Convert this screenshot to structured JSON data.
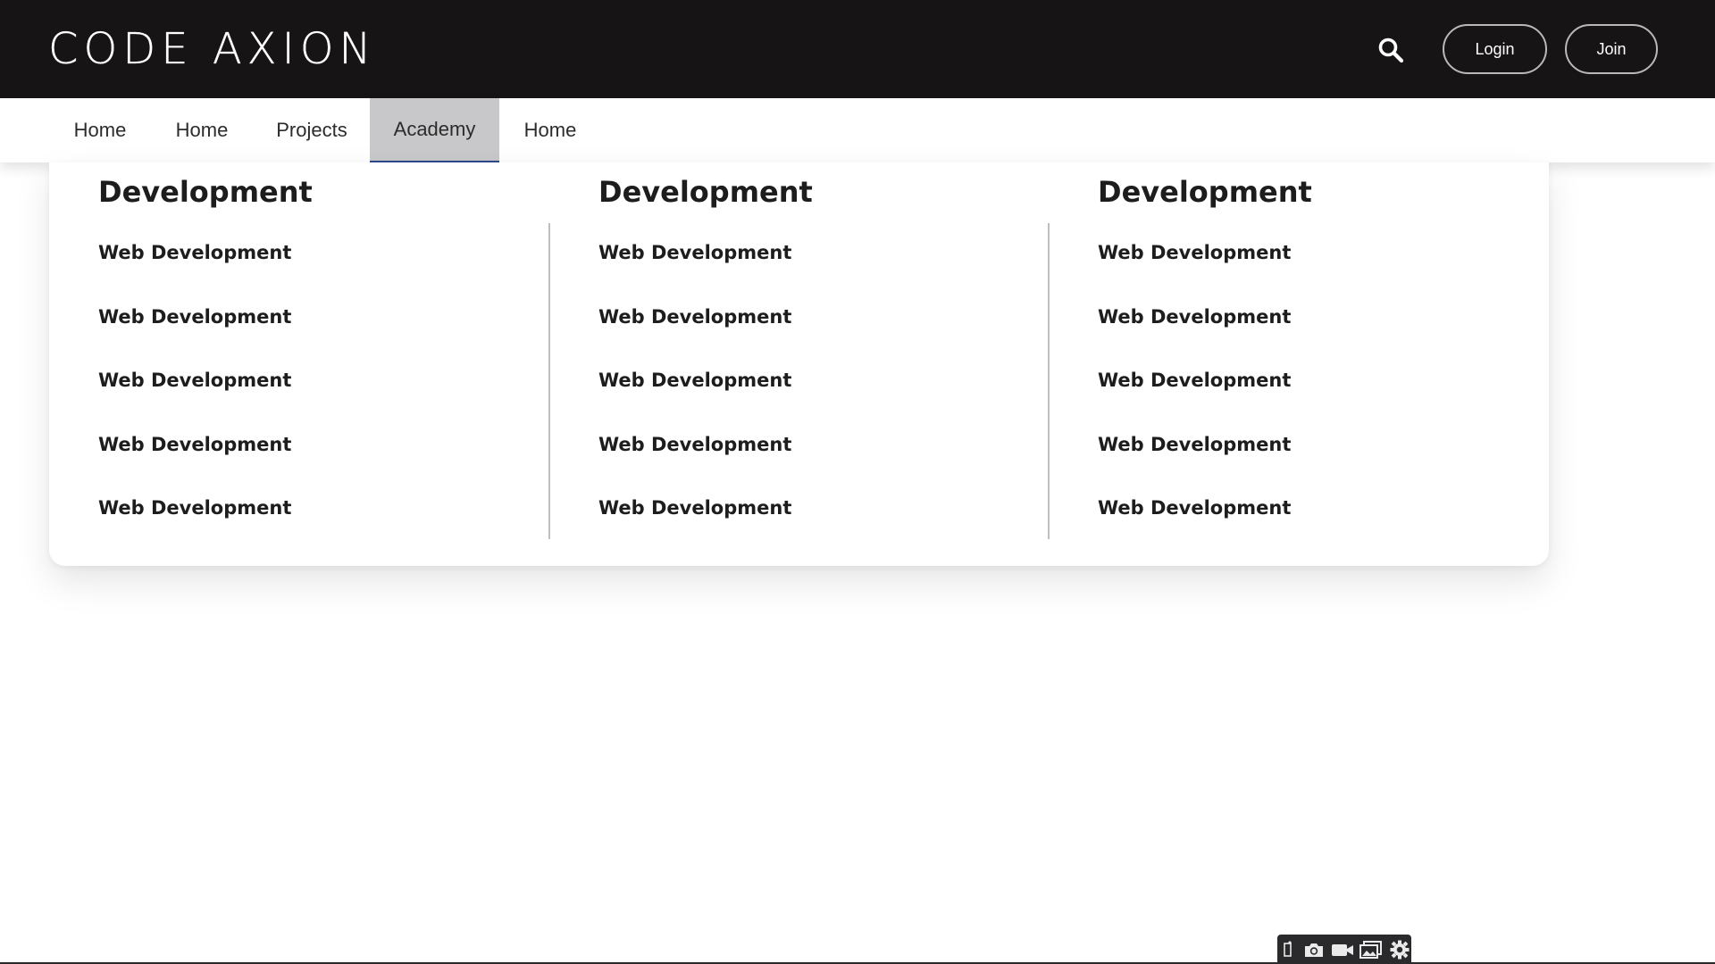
{
  "header": {
    "logo_text": "CODE AXION",
    "search_icon": "search-icon",
    "login_label": "Login",
    "join_label": "Join"
  },
  "nav": {
    "items": [
      {
        "label": "Home"
      },
      {
        "label": "Home"
      },
      {
        "label": "Projects"
      },
      {
        "label": "Academy",
        "active": true
      },
      {
        "label": "Home"
      }
    ]
  },
  "mega_menu": {
    "columns": [
      {
        "title": "Development",
        "links": [
          "Web Development",
          "Web Development",
          "Web Development",
          "Web Development",
          "Web Development"
        ]
      },
      {
        "title": "Development",
        "links": [
          "Web Development",
          "Web Development",
          "Web Development",
          "Web Development",
          "Web Development"
        ]
      },
      {
        "title": "Development",
        "links": [
          "Web Development",
          "Web Development",
          "Web Development",
          "Web Development",
          "Web Development"
        ]
      }
    ]
  },
  "capture_toolbar": {
    "icons": [
      "pin-icon",
      "camera-icon",
      "video-icon",
      "gallery-icon",
      "gear-icon"
    ]
  },
  "colors": {
    "header_bg": "#161415",
    "active_tab_bg": "#c8c8ca",
    "active_tab_underline": "#2f4a8f"
  }
}
